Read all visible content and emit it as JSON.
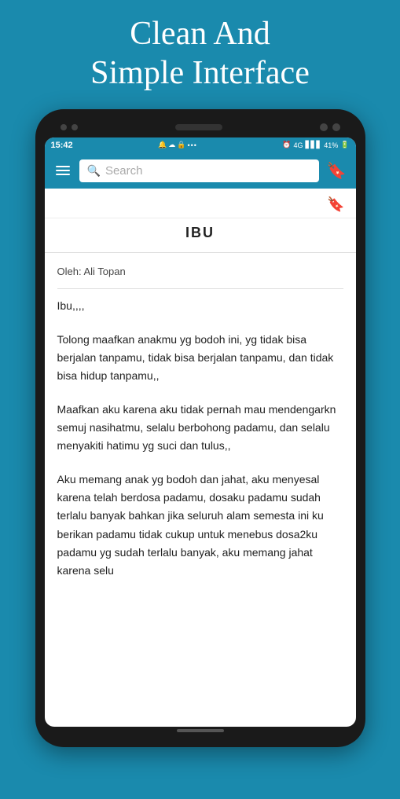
{
  "header": {
    "title": "Clean And\nSimple Interface"
  },
  "phone": {
    "status_bar": {
      "time": "15:42",
      "icons_left": "📷☁🔒 •••",
      "icons_right": "⏰ 4G 41%"
    },
    "toolbar": {
      "hamburger_label": "Menu",
      "search_placeholder": "Search",
      "bookmark_label": "Bookmark"
    },
    "poem": {
      "title": "IBU",
      "author": "Oleh: Ali Topan",
      "stanzas": [
        "Ibu,,,,",
        "Tolong maafkan anakmu yg bodoh ini, yg tidak bisa berjalan tanpamu, tidak bisa berjalan tanpamu, dan tidak bisa hidup tanpamu,,",
        "Maafkan aku karena aku tidak pernah mau mendengarkn semuj nasihatmu, selalu berbohong padamu, dan selalu menyakiti hatimu yg suci dan tulus,,",
        "Aku memang anak yg bodoh dan jahat, aku menyesal karena telah berdosa padamu, dosaku padamu sudah terlalu banyak bahkan jika seluruh alam semesta ini ku berikan padamu tidak cukup untuk menebus dosa2ku padamu yg sudah terlalu banyak, aku memang jahat karena selu"
      ]
    }
  }
}
